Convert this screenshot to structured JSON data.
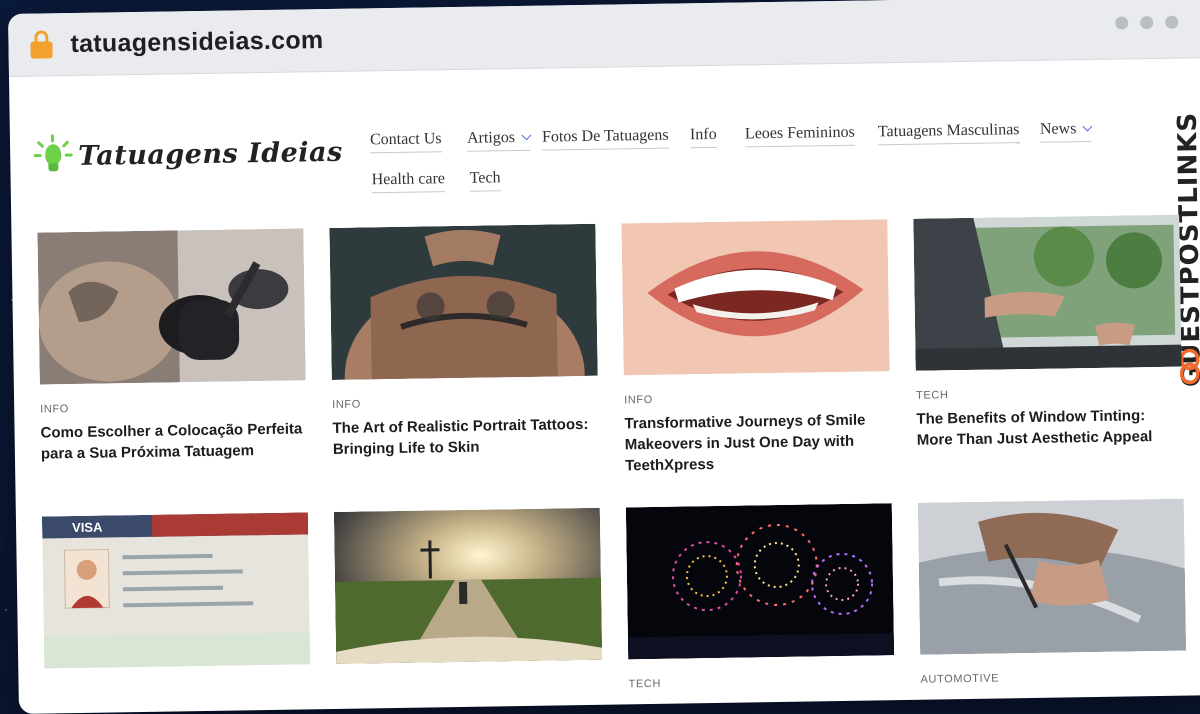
{
  "browser": {
    "url": "tatuagensideias.com"
  },
  "site": {
    "logo_text": "Tatuagens Ideias",
    "accent_color": "#6fd14a"
  },
  "nav": {
    "items": [
      {
        "label": "Contact Us",
        "dropdown": false
      },
      {
        "label": "Artigos",
        "dropdown": true
      },
      {
        "label": "Fotos De Tatuagens",
        "dropdown": false
      },
      {
        "label": "Info",
        "dropdown": false
      },
      {
        "label": "Leoes Femininos",
        "dropdown": false
      },
      {
        "label": "Tatuagens Masculinas",
        "dropdown": false
      },
      {
        "label": "News",
        "dropdown": true
      },
      {
        "label": "Health care",
        "dropdown": false
      },
      {
        "label": "Tech",
        "dropdown": false
      }
    ]
  },
  "watermark": {
    "text": "GUESTPOSTLINKS"
  },
  "articles": [
    {
      "category": "INFO",
      "title": "Como Escolher a Colocação Perfeita para a Sua Próxima Tatuagem",
      "image": "tattoo-artist-working"
    },
    {
      "category": "INFO",
      "title": "The Art of Realistic Portrait Tattoos: Bringing Life to Skin",
      "image": "tattooed-back"
    },
    {
      "category": "INFO",
      "title": "Transformative Journeys of Smile Makeovers in Just One Day with TeethXpress",
      "image": "smile-teeth"
    },
    {
      "category": "TECH",
      "title": "The Benefits of Window Tinting: More Than Just Aesthetic Appeal",
      "image": "car-window-tint"
    },
    {
      "category": "",
      "title": "",
      "image": "visa-document"
    },
    {
      "category": "",
      "title": "",
      "image": "path-to-cross"
    },
    {
      "category": "TECH",
      "title": "",
      "image": "fireworks"
    },
    {
      "category": "AUTOMOTIVE",
      "title": "",
      "image": "car-wrap-film"
    }
  ]
}
